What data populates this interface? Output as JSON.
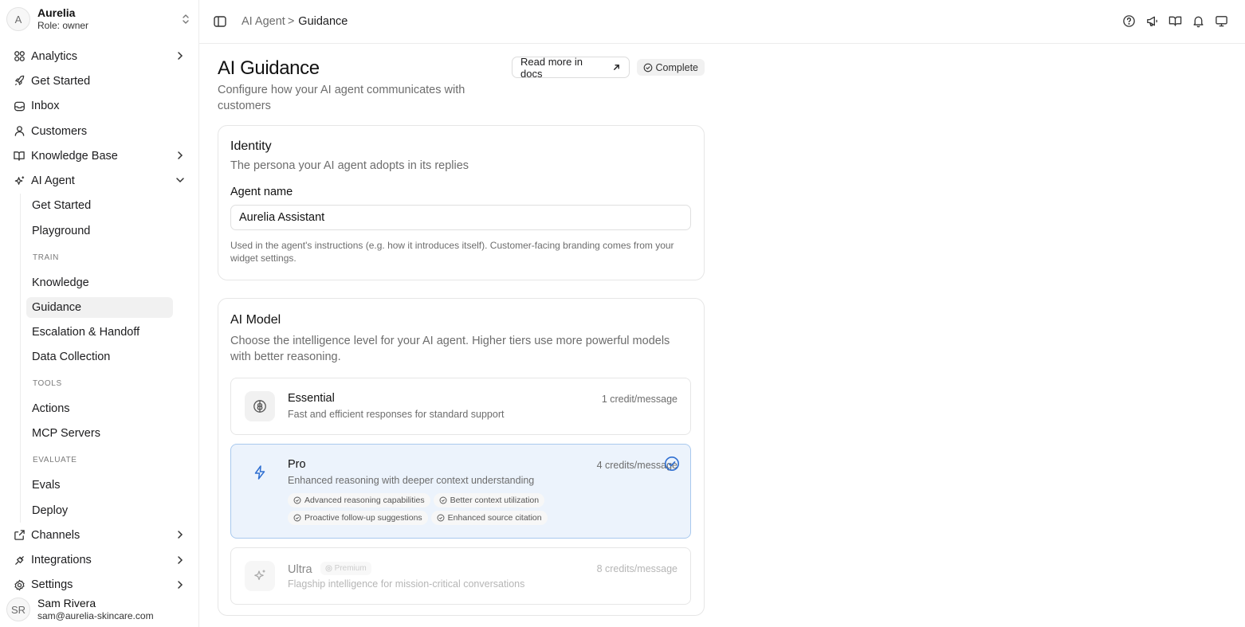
{
  "workspace": {
    "avatar_initial": "A",
    "name": "Aurelia",
    "role": "Role: owner"
  },
  "nav": {
    "analytics": "Analytics",
    "get_started": "Get Started",
    "inbox": "Inbox",
    "customers": "Customers",
    "knowledge_base": "Knowledge Base",
    "ai_agent": "AI Agent",
    "channels": "Channels",
    "integrations": "Integrations",
    "settings": "Settings"
  },
  "ai_agent_sub": {
    "get_started": "Get Started",
    "playground": "Playground",
    "section_train": "TRAIN",
    "knowledge": "Knowledge",
    "guidance": "Guidance",
    "escalation": "Escalation & Handoff",
    "data_collection": "Data Collection",
    "section_tools": "TOOLS",
    "actions": "Actions",
    "mcp_servers": "MCP Servers",
    "section_evaluate": "EVALUATE",
    "evals": "Evals",
    "deploy": "Deploy"
  },
  "user": {
    "initials": "SR",
    "name": "Sam Rivera",
    "email": "sam@aurelia-skincare.com"
  },
  "breadcrumb": {
    "parent": "AI Agent",
    "separator": ">",
    "current": "Guidance"
  },
  "page": {
    "title": "AI Guidance",
    "description": "Configure how your AI agent communicates with customers",
    "docs_button": "Read more in docs",
    "status_badge": "Complete"
  },
  "identity": {
    "title": "Identity",
    "description": "The persona your AI agent adopts in its replies",
    "agent_name_label": "Agent name",
    "agent_name_value": "Aurelia Assistant",
    "hint": "Used in the agent's instructions (e.g. how it introduces itself). Customer-facing branding comes from your widget settings."
  },
  "ai_model": {
    "title": "AI Model",
    "description": "Choose the intelligence level for your AI agent. Higher tiers use more powerful models with better reasoning.",
    "tiers": [
      {
        "name": "Essential",
        "description": "Fast and efficient responses for standard support",
        "cost": "1 credit/message"
      },
      {
        "name": "Pro",
        "description": "Enhanced reasoning with deeper context understanding",
        "cost": "4 credits/message",
        "features": [
          "Advanced reasoning capabilities",
          "Better context utilization",
          "Proactive follow-up suggestions",
          "Enhanced source citation"
        ]
      },
      {
        "name": "Ultra",
        "badge": "Premium",
        "description": "Flagship intelligence for mission-critical conversations",
        "cost": "8 credits/message"
      }
    ],
    "selected_tier": "Pro"
  },
  "icons": {
    "analytics": "grid-icon",
    "get_started": "rocket-icon",
    "inbox": "inbox-icon",
    "customers": "user-icon",
    "knowledge_base": "book-icon",
    "ai_agent": "sparkle-icon",
    "channels": "share-icon",
    "integrations": "plug-icon",
    "settings": "gear-icon",
    "topbar": [
      "help-icon",
      "megaphone-icon",
      "book-icon",
      "bell-icon",
      "monitor-icon"
    ]
  },
  "colors": {
    "accent": "#2f6fd1",
    "selected_bg": "#ecf3fc",
    "selected_border": "#a9c9ee"
  }
}
